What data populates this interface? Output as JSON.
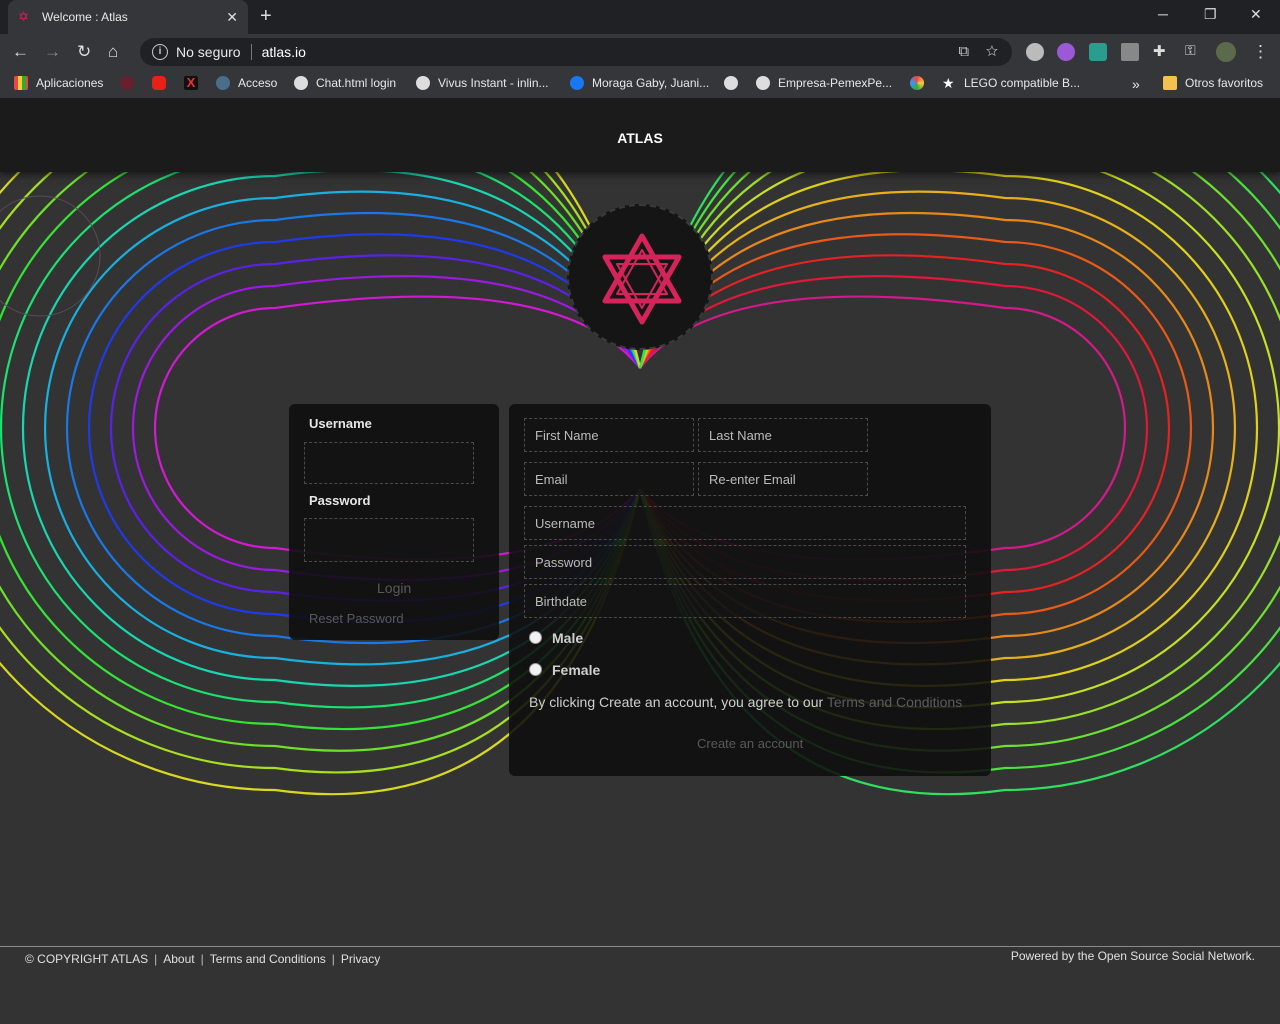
{
  "browser": {
    "tab_title": "Welcome : Atlas",
    "tab_close": "✕",
    "new_tab": "+",
    "security_label": "No seguro",
    "url": "atlas.io",
    "window_controls": [
      "─",
      "❐",
      "✕"
    ],
    "bookmarks": [
      {
        "label": "Aplicaciones",
        "icon": "apps-grid-icon"
      },
      {
        "label": "",
        "icon": "atlas-star-icon"
      },
      {
        "label": "",
        "icon": "youtube-icon"
      },
      {
        "label": "",
        "icon": "x-icon"
      },
      {
        "label": "Acceso",
        "icon": "acceso-icon"
      },
      {
        "label": "Chat.html login",
        "icon": "globe-icon"
      },
      {
        "label": "Vivus Instant - inlin...",
        "icon": "globe-icon"
      },
      {
        "label": "Moraga Gaby, Juani...",
        "icon": "facebook-icon"
      },
      {
        "label": "",
        "icon": "globe-icon"
      },
      {
        "label": "Empresa-PemexPe...",
        "icon": "globe-icon"
      },
      {
        "label": "",
        "icon": "pinwheel-icon"
      },
      {
        "label": "LEGO compatible B...",
        "icon": "star-icon"
      },
      {
        "label": "»",
        "icon": "overflow-chevron-icon"
      },
      {
        "label": "Otros favoritos",
        "icon": "folder-icon"
      }
    ]
  },
  "site": {
    "brand": "ATLAS",
    "accent": "#d6245a"
  },
  "login": {
    "username_label": "Username",
    "password_label": "Password",
    "login_button": "Login",
    "reset_link": "Reset Password"
  },
  "signup": {
    "first_name_placeholder": "First Name",
    "last_name_placeholder": "Last Name",
    "email_placeholder": "Email",
    "reenter_email_placeholder": "Re-enter Email",
    "username_placeholder": "Username",
    "password_placeholder": "Password",
    "birthdate_placeholder": "Birthdate",
    "gender_options": [
      "Male",
      "Female"
    ],
    "agree_text": "By clicking Create an account, you agree to our ",
    "terms_link": "Terms and Conditions",
    "create_button": "Create an account"
  },
  "footer": {
    "copyright": "© COPYRIGHT ATLAS",
    "links": [
      "About",
      "Terms and Conditions",
      "Privacy"
    ],
    "powered_by": "Powered by the Open Source Social Network."
  }
}
